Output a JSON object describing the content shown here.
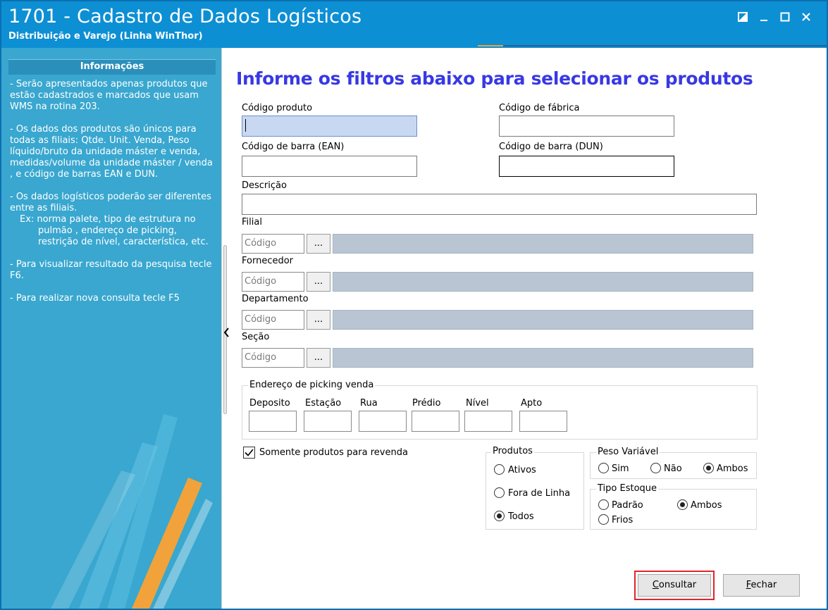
{
  "window": {
    "title": "1701 - Cadastro de Dados Logísticos",
    "subtitle": "Distribuição e Varejo (Linha WinThor)",
    "controls": [
      "restore-icon",
      "minimize-icon",
      "maximize-icon",
      "close-icon"
    ]
  },
  "sidebar": {
    "header": "Informações",
    "paragraphs": [
      "- Serão apresentados apenas produtos que estão cadastrados e marcados que usam WMS na rotina 203.",
      "- Os dados dos produtos são únicos para todas as filiais: Qtde. Unit. Venda, Peso líquido/bruto da unidade máster e venda, medidas/volume da unidade máster / venda , e código de barras EAN e DUN.",
      "- Os dados logísticos poderão ser diferentes entre as filiais.",
      "Ex: norma palete, tipo de estrutura no pulmão , endereço de picking, restrição de nível, característica, etc.",
      "- Para visualizar resultado da pesquisa tecle F6.",
      "- Para realizar nova consulta tecle F5"
    ]
  },
  "main": {
    "heading": "Informe os filtros abaixo para selecionar os produtos",
    "codigo_produto": {
      "label": "Código produto",
      "value": ""
    },
    "codigo_fabrica": {
      "label": "Código de fábrica",
      "value": ""
    },
    "codigo_ean": {
      "label": "Código de barra (EAN)",
      "value": ""
    },
    "codigo_dun": {
      "label": "Código de barra (DUN)",
      "value": ""
    },
    "descricao": {
      "label": "Descrição",
      "value": ""
    },
    "lookups": [
      {
        "label": "Filial",
        "placeholder": "Código",
        "button": "..."
      },
      {
        "label": "Fornecedor",
        "placeholder": "Código",
        "button": "..."
      },
      {
        "label": "Departamento",
        "placeholder": "Código",
        "button": "..."
      },
      {
        "label": "Seção",
        "placeholder": "Código",
        "button": "..."
      }
    ],
    "picking": {
      "title": "Endereço de picking venda",
      "fields": [
        "Deposito",
        "Estação",
        "Rua",
        "Prédio",
        "Nível",
        "Apto"
      ]
    },
    "somente_revenda": {
      "label": "Somente produtos para revenda",
      "checked": true
    },
    "produtos": {
      "title": "Produtos",
      "options": [
        "Ativos",
        "Fora de Linha",
        "Todos"
      ],
      "selected": "Todos"
    },
    "peso_variavel": {
      "title": "Peso Variável",
      "options": [
        "Sim",
        "Não",
        "Ambos"
      ],
      "selected": "Ambos"
    },
    "tipo_estoque": {
      "title": "Tipo Estoque",
      "options": [
        "Padrão",
        "Ambos",
        "Frios"
      ],
      "selected": "Ambos"
    },
    "buttons": {
      "consultar": {
        "label": "Consultar",
        "underline": "C",
        "rest": "onsultar"
      },
      "fechar": {
        "label": "Fechar",
        "underline": "F",
        "rest": "echar"
      }
    }
  },
  "colors": {
    "titlebar": "#0d8fd4",
    "sidebar": "#39a7cf",
    "heading": "#3838e4",
    "focus_border": "#e0252b"
  }
}
